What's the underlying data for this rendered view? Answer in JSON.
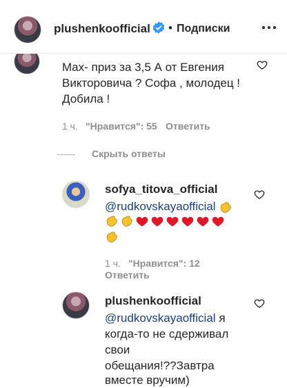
{
  "header": {
    "username": "plushenkoofficial",
    "separator": "•",
    "follow_label": "Подписки"
  },
  "comment": {
    "text_line1": "Max- приз за 3,5 А от Евгения",
    "text_line2": "Викторовича ? Софа , молодец !",
    "text_line3": "Добила !",
    "time": "1 ч.",
    "likes": "\"Нравится\": 55",
    "reply_label": "Ответить"
  },
  "hide_replies_label": "Скрыть ответы",
  "reply1": {
    "username": "sofya_titova_official",
    "mention": "@rudkovskayaofficial",
    "time": "1 ч.",
    "likes": "\"Нравится\": 12",
    "reply_label": "Ответить"
  },
  "reply2": {
    "username": "plushenkoofficial",
    "mention": "@rudkovskayaofficial",
    "text_line1": "я",
    "text_line2": "когда-то не сдерживал",
    "text_line3": "свои",
    "text_line4": "обещания!??Завтра",
    "text_line5": "вместе вручим)"
  },
  "colors": {
    "verified": "#3897f0",
    "link": "#1d3f73",
    "muted": "#8e8e8e",
    "heart": "#e0162b",
    "clap": "#f7c331"
  },
  "icons": [
    "verified-badge-icon",
    "more-options-icon",
    "heart-outline-icon",
    "clap-emoji",
    "red-heart-emoji"
  ]
}
